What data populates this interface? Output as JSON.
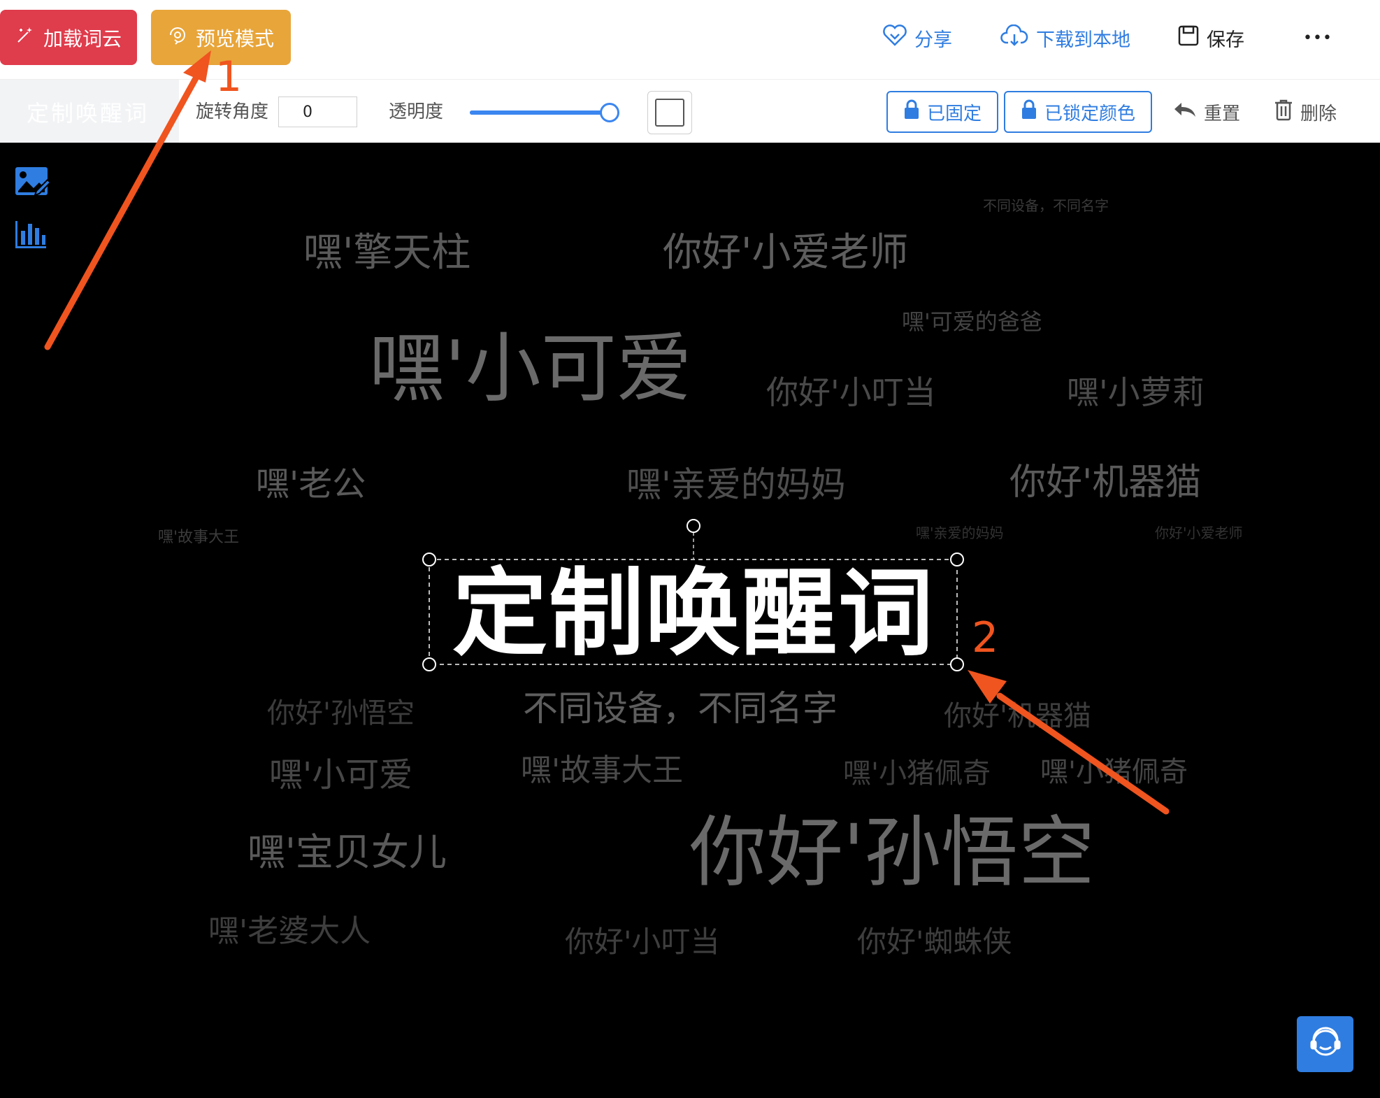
{
  "topbar": {
    "load_label": "加载词云",
    "preview_label": "预览模式",
    "share_label": "分享",
    "download_label": "下载到本地",
    "save_label": "保存",
    "more_label": "•••"
  },
  "toolbar": {
    "tab_label": "定制唤醒词",
    "rotation_label": "旋转角度",
    "rotation_value": "0",
    "opacity_label": "透明度",
    "opacity_value": 1.0,
    "fixed_label": "已固定",
    "lock_color_label": "已锁定颜色",
    "reset_label": "重置",
    "delete_label": "删除"
  },
  "canvas": {
    "background": "#000000",
    "selected_word": "定制唤醒词",
    "words": [
      {
        "text": "不同设备，不同名字",
        "color": "#3a3a3a"
      },
      {
        "text": "嘿'擎天柱",
        "color": "#5a5a5a"
      },
      {
        "text": "你好'小爱老师",
        "color": "#5e5e5e"
      },
      {
        "text": "嘿'可爱的爸爸",
        "color": "#444444"
      },
      {
        "text": "嘿'小可爱",
        "color": "#6a6a6a"
      },
      {
        "text": "你好'小叮当",
        "color": "#4a4a4a"
      },
      {
        "text": "嘿'小萝莉",
        "color": "#4c4c4c"
      },
      {
        "text": "嘿'老公",
        "color": "#5a5a5a"
      },
      {
        "text": "嘿'亲爱的妈妈",
        "color": "#4e4e4e"
      },
      {
        "text": "你好'机器猫",
        "color": "#5a5a5a"
      },
      {
        "text": "嘿'故事大王",
        "color": "#3c3c3c"
      },
      {
        "text": "嘿'亲爱的妈妈",
        "color": "#333333"
      },
      {
        "text": "你好'小爱老师",
        "color": "#333333"
      },
      {
        "text": "你好'孙悟空",
        "color": "#3c3c3c"
      },
      {
        "text": "不同设备，不同名字",
        "color": "#5e5e5e"
      },
      {
        "text": "你好'机器猫",
        "color": "#3e3e3e"
      },
      {
        "text": "嘿'小可爱",
        "color": "#474747"
      },
      {
        "text": "嘿'故事大王",
        "color": "#4a4a4a"
      },
      {
        "text": "嘿'小猪佩奇",
        "color": "#3e3e3e"
      },
      {
        "text": "嘿'小猪佩奇",
        "color": "#464646"
      },
      {
        "text": "嘿'宝贝女儿",
        "color": "#5a5a5a"
      },
      {
        "text": "你好'孙悟空",
        "color": "#6a6a6a"
      },
      {
        "text": "嘿'老婆大人",
        "color": "#3e3e3e"
      },
      {
        "text": "你好'小叮当",
        "color": "#3e3e3e"
      },
      {
        "text": "你好'蜘蛛侠",
        "color": "#3e3e3e"
      }
    ]
  },
  "annotations": {
    "label_1": "1",
    "label_2": "2",
    "arrow_color": "#f0541f"
  },
  "colors": {
    "load_button": "#df3c4c",
    "preview_button": "#e8a53a",
    "accent_blue": "#2f7de1"
  }
}
